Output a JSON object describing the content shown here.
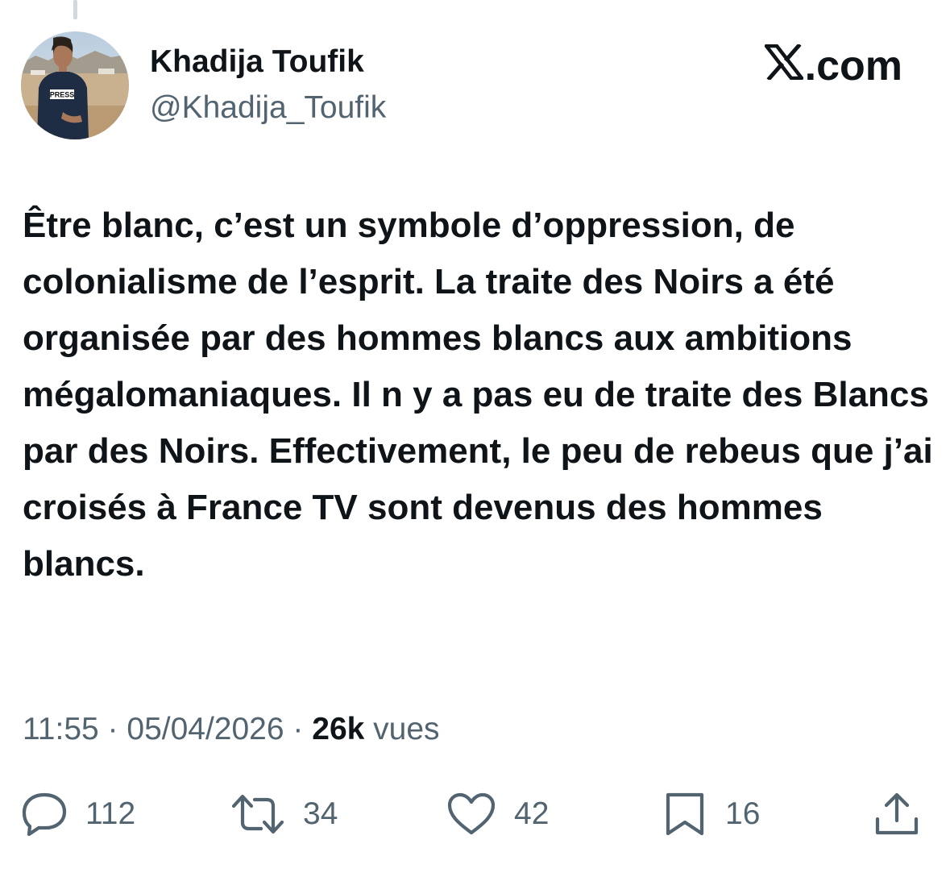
{
  "author": {
    "name": "Khadija Toufik",
    "handle": "@Khadija_Toufik",
    "avatar_badge_text": "PRESS"
  },
  "brand": {
    "icon": "x-logo-icon",
    "suffix": ".com"
  },
  "tweet": {
    "text": "Être blanc, c’est un symbole d’oppression, de colonialisme de l’esprit. La traite des Noirs a été organisée par des hommes blancs aux ambitions mégalomaniaques. Il n y a pas eu de traite des Blancs par des Noirs. Effectivement, le peu de rebeus que j’ai croisés à France TV sont devenus des hommes blancs."
  },
  "meta": {
    "time": "11:55",
    "separator": " · ",
    "date": "05/04/2026",
    "views_count": "26k",
    "views_label": " vues"
  },
  "actions": {
    "reply": {
      "icon": "reply-icon",
      "count": "112"
    },
    "repost": {
      "icon": "repost-icon",
      "count": "34"
    },
    "like": {
      "icon": "heart-icon",
      "count": "42"
    },
    "bookmark": {
      "icon": "bookmark-icon",
      "count": "16"
    },
    "share": {
      "icon": "share-icon"
    }
  },
  "colors": {
    "text": "#0f1419",
    "secondary": "#536471",
    "thread_line": "#cfd9de"
  }
}
